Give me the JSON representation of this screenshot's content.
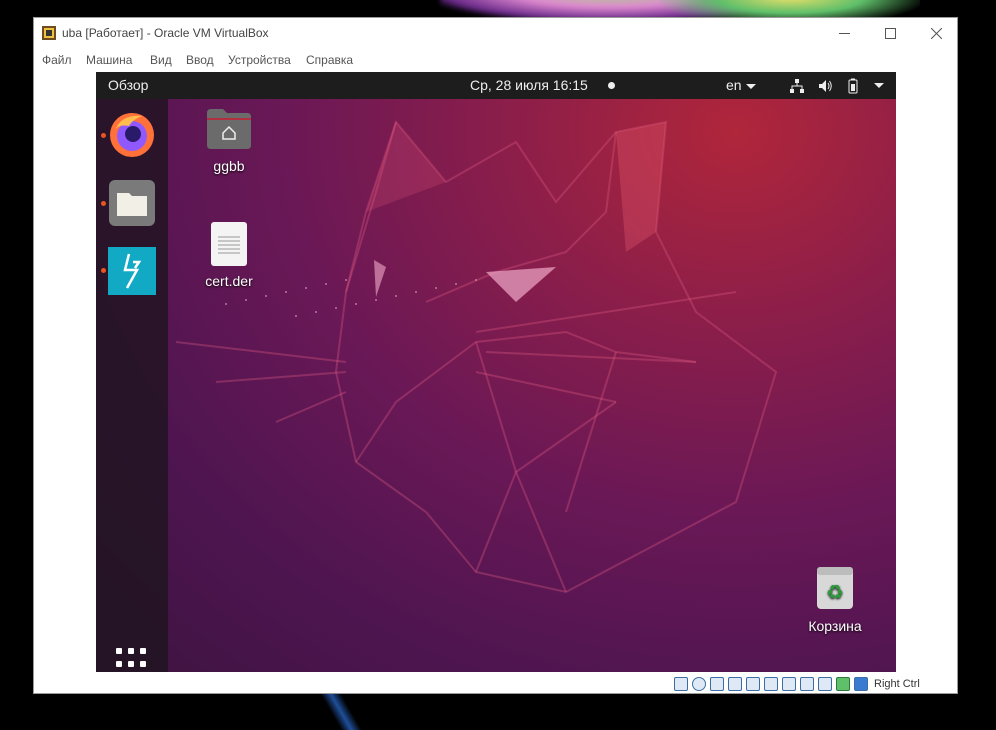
{
  "window": {
    "title": "uba [Работает] - Oracle VM VirtualBox"
  },
  "menu": {
    "items": [
      "Файл",
      "Машина",
      "Вид",
      "Ввод",
      "Устройства",
      "Справка"
    ]
  },
  "guest": {
    "topbar": {
      "activities": "Обзор",
      "datetime": "Ср, 28 июля  16:15",
      "language": "en"
    },
    "dock": [
      {
        "name": "Firefox",
        "icon": "firefox-icon",
        "running": true
      },
      {
        "name": "Files",
        "icon": "files-icon",
        "running": true
      },
      {
        "name": "Thunder app",
        "icon": "lightning-icon",
        "running": true
      }
    ],
    "desktop_icons": [
      {
        "label": "ggbb",
        "icon": "home-folder-icon"
      },
      {
        "label": "cert.der",
        "icon": "document-icon"
      },
      {
        "label": "Корзина",
        "icon": "trash-icon"
      }
    ]
  },
  "statusbar": {
    "host_key": "Right Ctrl"
  },
  "colors": {
    "ubuntu_orange": "#e95420",
    "topbar": "#1d1d1d"
  }
}
